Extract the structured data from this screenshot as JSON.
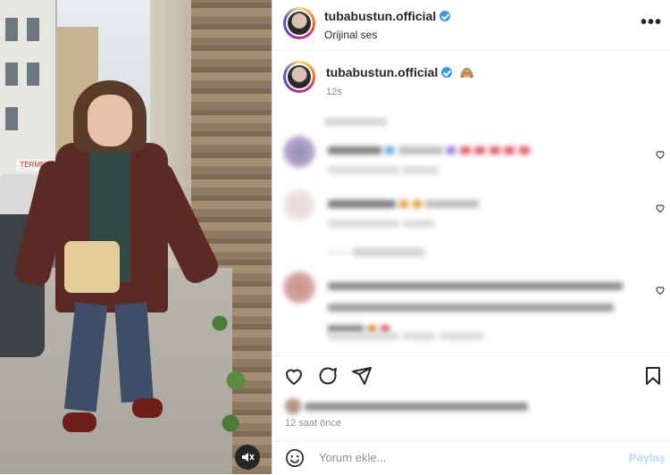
{
  "media": {
    "sign_text": "TERMES",
    "mute_icon": "speaker-muted-icon"
  },
  "header": {
    "username": "tubabustun.official",
    "subtitle": "Orijinal ses",
    "more_icon": "more-dots-icon"
  },
  "caption": {
    "username": "tubabustun.official",
    "emoji": "🙈",
    "time": "12s"
  },
  "actions": {
    "like_icon": "heart-icon",
    "comment_icon": "comment-icon",
    "share_icon": "send-icon",
    "save_icon": "bookmark-icon"
  },
  "footer": {
    "timestamp": "12 saat önce",
    "comment_placeholder": "Yorum ekle...",
    "post_label": "Paylaş"
  },
  "colors": {
    "verified": "#3897f0",
    "post_button": "#b3dbff",
    "text": "#262626",
    "muted": "#8e8e8e"
  }
}
